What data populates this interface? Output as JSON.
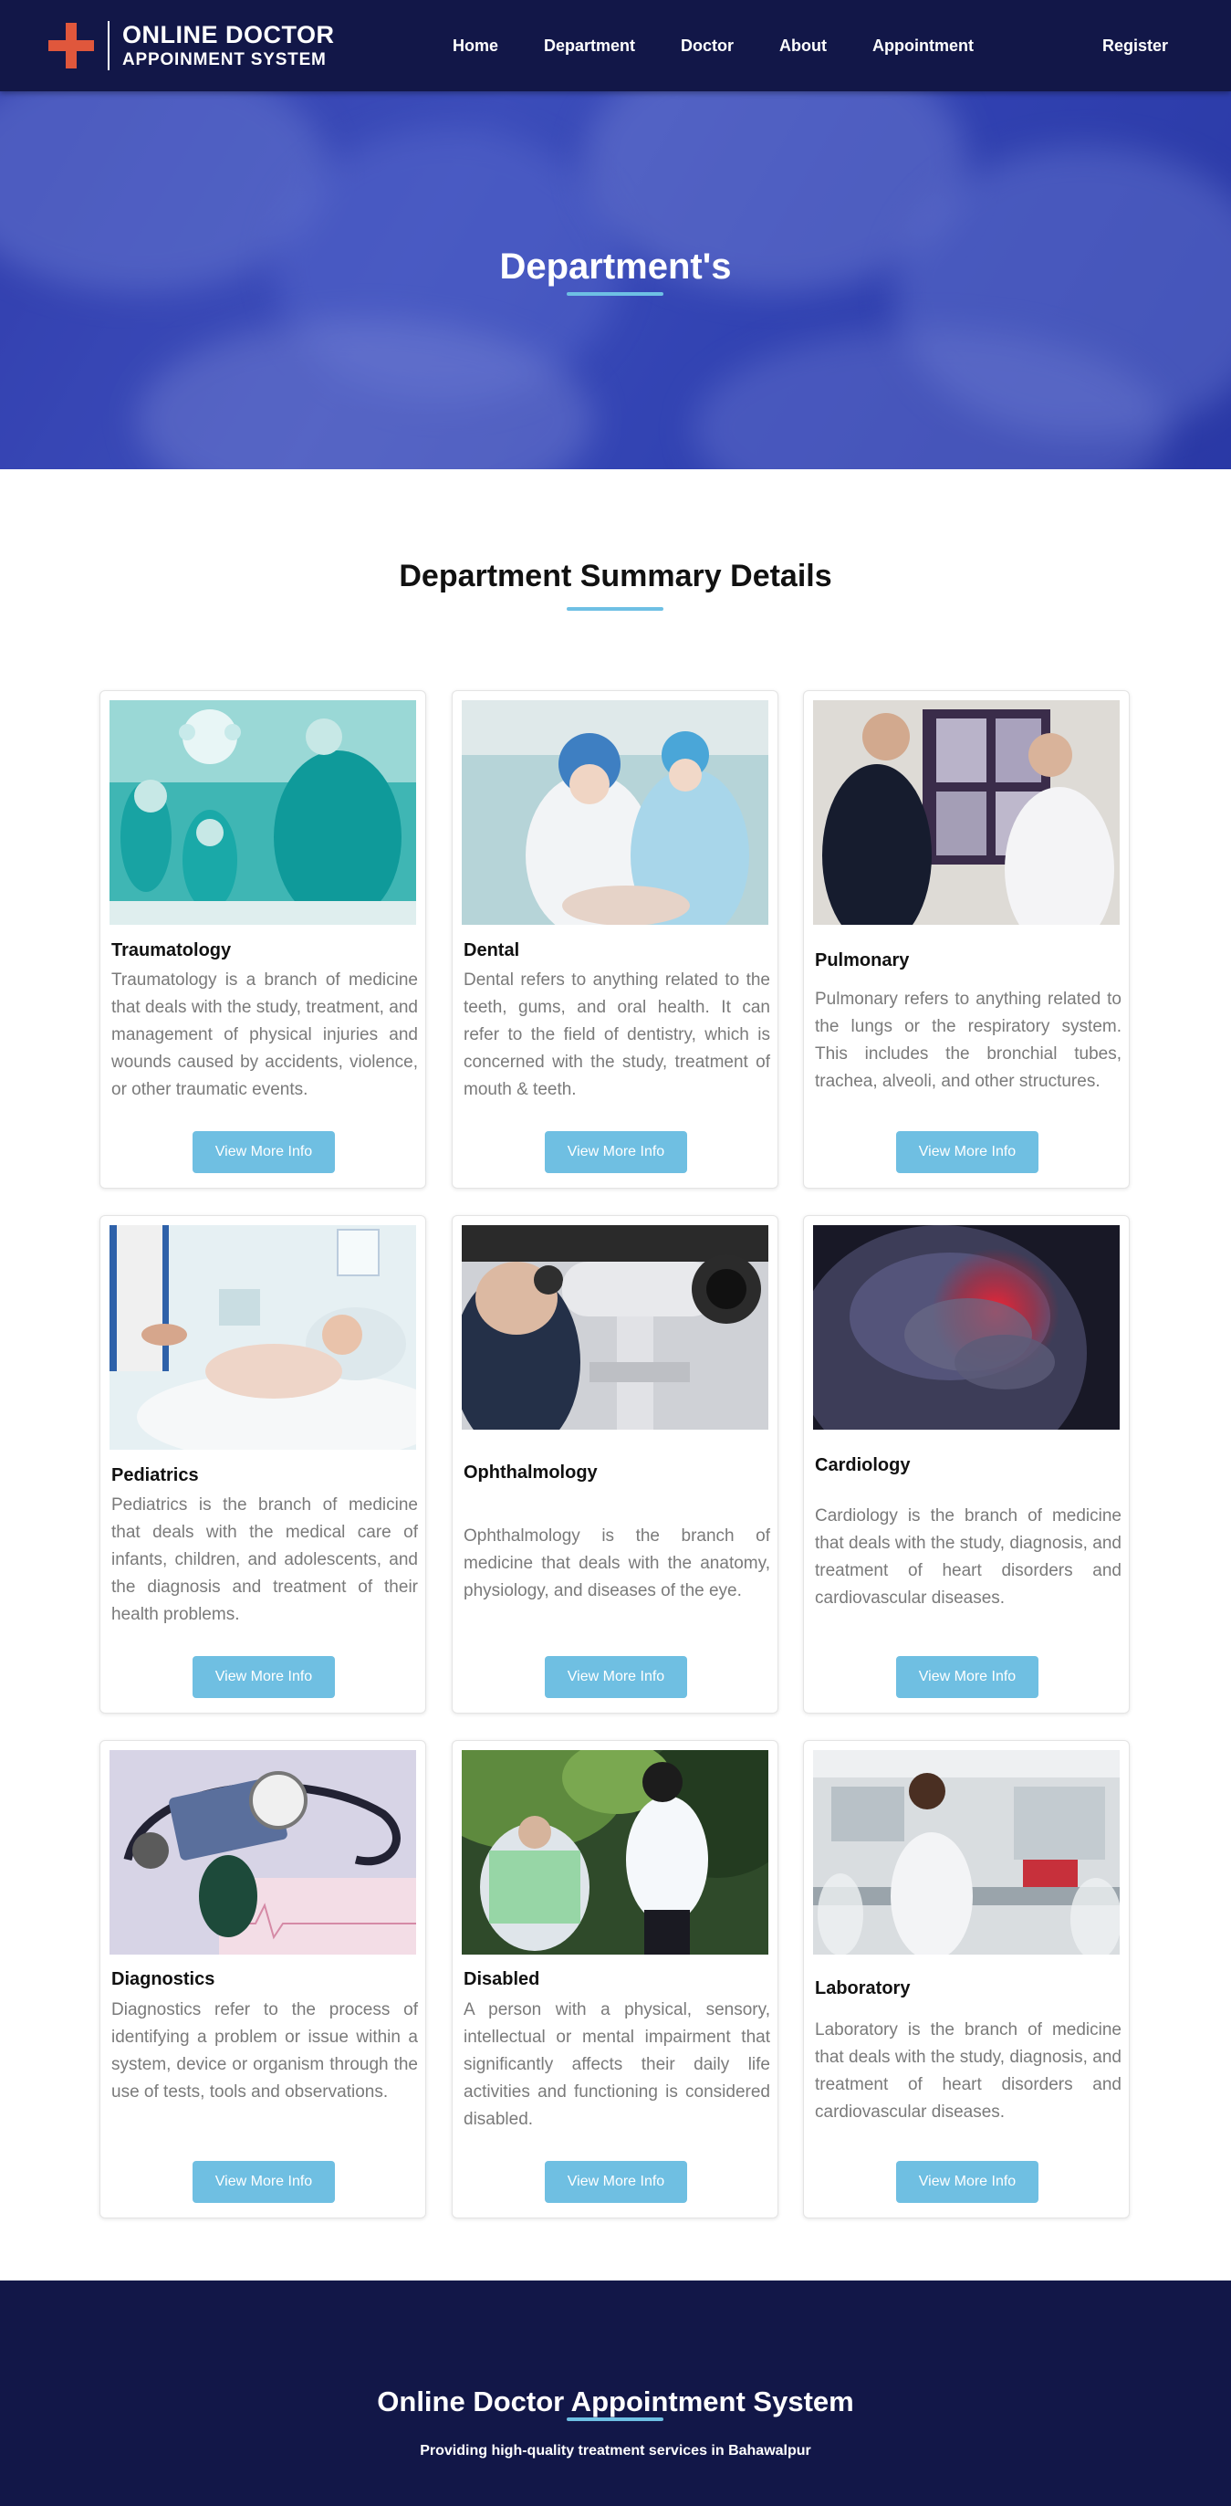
{
  "brand": {
    "line1": "ONLINE DOCTOR",
    "line2": "APPOINMENT SYSTEM",
    "accent_color": "#e0573c"
  },
  "nav": {
    "links": [
      "Home",
      "Department",
      "Doctor",
      "About",
      "Appointment"
    ],
    "register": "Register"
  },
  "hero": {
    "title": "Department's"
  },
  "section": {
    "title": "Department Summary Details",
    "underline_color": "#6ec0e4"
  },
  "departments": [
    {
      "name": "Traumatology",
      "description": "Traumatology is a branch of medicine that deals with the study, treatment, and management of physical injuries and wounds caused by accidents, violence, or other traumatic events.",
      "button": "View More Info"
    },
    {
      "name": "Dental",
      "description": "Dental refers to anything related to the teeth, gums, and oral health. It can refer to the field of dentistry, which is concerned with the study, treatment of mouth & teeth.",
      "button": "View More Info"
    },
    {
      "name": "Pulmonary",
      "description": "Pulmonary refers to anything related to the lungs or the respiratory system. This includes the bronchial tubes, trachea, alveoli, and other structures.",
      "button": "View More Info"
    },
    {
      "name": "Pediatrics",
      "description": "Pediatrics is the branch of medicine that deals with the medical care of infants, children, and adolescents, and the diagnosis and treatment of their health problems.",
      "button": "View More Info"
    },
    {
      "name": "Ophthalmology",
      "description": "Ophthalmology is the branch of medicine that deals with the anatomy, physiology, and diseases of the eye.",
      "button": "View More Info"
    },
    {
      "name": "Cardiology",
      "description": "Cardiology is the branch of medicine that deals with the study, diagnosis, and treatment of heart disorders and cardiovascular diseases.",
      "button": "View More Info"
    },
    {
      "name": "Diagnostics",
      "description": "Diagnostics refer to the process of identifying a problem or issue within a system, device or organism through the use of tests, tools and observations.",
      "button": "View More Info"
    },
    {
      "name": "Disabled",
      "description": "A person with a physical, sensory, intellectual or mental impairment that significantly affects their daily life activities and functioning is considered disabled.",
      "button": "View More Info"
    },
    {
      "name": "Laboratory",
      "description": "Laboratory is the branch of medicine that deals with the study, diagnosis, and treatment of heart disorders and cardiovascular diseases.",
      "button": "View More Info"
    }
  ],
  "footer": {
    "title": "Online Doctor Appointment System",
    "subtitle": "Providing high-quality treatment services in Bahawalpur",
    "background": "#121748"
  }
}
